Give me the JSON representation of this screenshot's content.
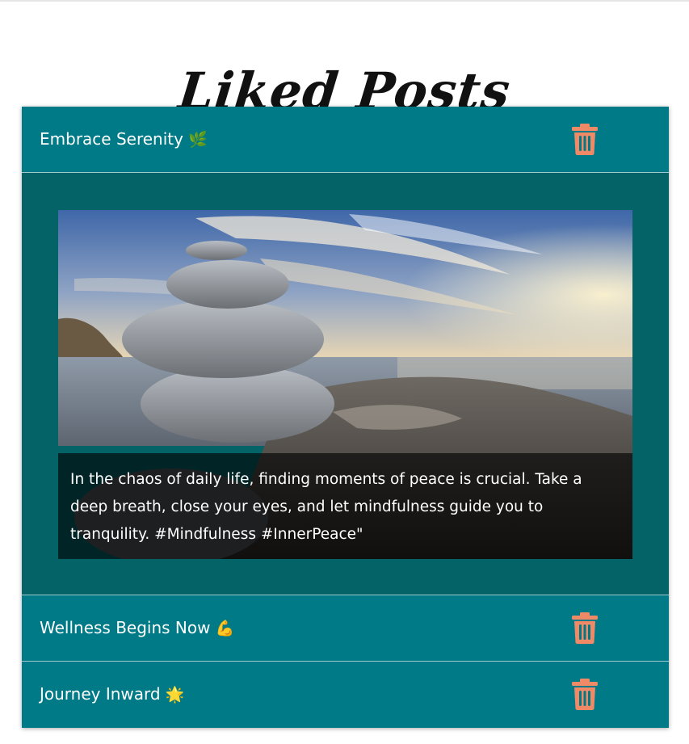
{
  "page": {
    "title": "Liked Posts"
  },
  "colors": {
    "header_bg": "#007a87",
    "body_bg": "#036366",
    "trash_icon": "#f08a66",
    "title_text": "#111111"
  },
  "posts": [
    {
      "title": "Embrace Serenity",
      "emoji": "🌿",
      "expanded": true,
      "image_description_icon": "stacked-stones-seascape-image",
      "caption": "In the chaos of daily life, finding moments of peace is crucial. Take a deep breath, close your eyes, and let mindfulness guide you to tranquility. #Mindfulness #InnerPeace\""
    },
    {
      "title": "Wellness Begins Now",
      "emoji": "💪",
      "expanded": false
    },
    {
      "title": "Journey Inward",
      "emoji": "🌟",
      "expanded": false
    }
  ],
  "icons": {
    "delete": "trash-icon"
  }
}
